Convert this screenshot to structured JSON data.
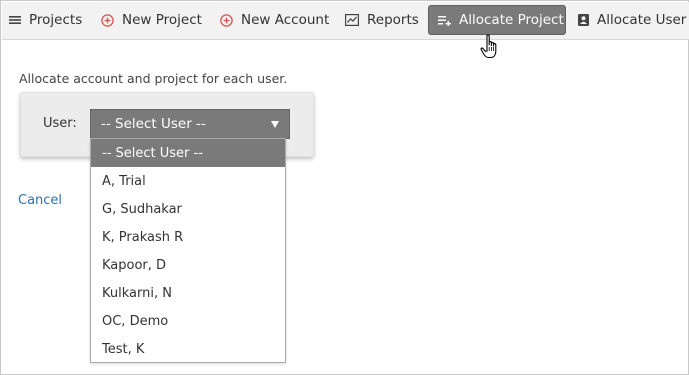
{
  "nav": {
    "items": [
      {
        "label": "Projects",
        "icon": "list-icon"
      },
      {
        "label": "New Project",
        "icon": "plus-circle-icon"
      },
      {
        "label": "New Account",
        "icon": "plus-circle-icon"
      },
      {
        "label": "Reports",
        "icon": "chart-icon"
      },
      {
        "label": "Allocate Project",
        "icon": "playlist-add-icon",
        "active": true
      },
      {
        "label": "Allocate User",
        "icon": "user-card-icon"
      }
    ]
  },
  "colors": {
    "navbar_bg": "#f2f2f2",
    "active_bg": "#7a7a7a",
    "accent_red": "#d9534f",
    "link_blue": "#2d6fb6"
  },
  "form": {
    "instruction": "Allocate account and project for each user.",
    "user_label": "User:",
    "select_value": "-- Select User --",
    "options": [
      "-- Select User --",
      "A, Trial",
      "G, Sudhakar",
      "K, Prakash R",
      "Kapoor, D",
      "Kulkarni, N",
      "OC, Demo",
      "Test, K"
    ],
    "cancel_label": "Cancel"
  }
}
